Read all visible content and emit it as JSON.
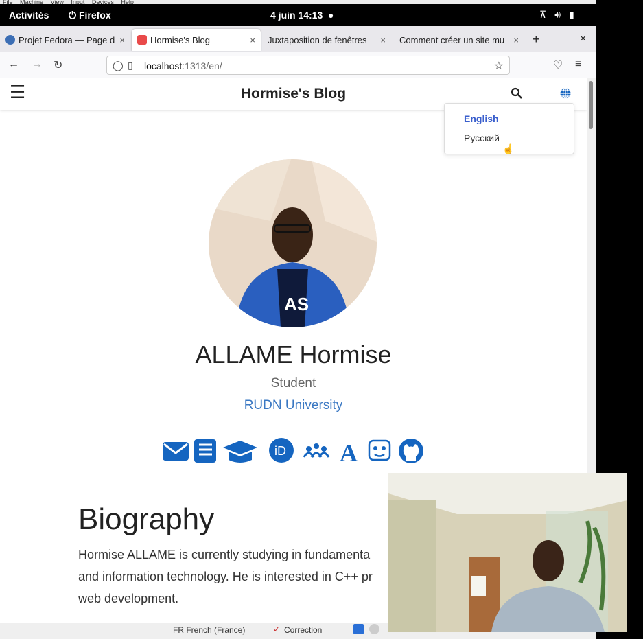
{
  "vm_menu": "File Machine View Input Devices Help",
  "topbar": {
    "activities": "Activités",
    "app": "Firefox",
    "clock": "4 juin 14:13"
  },
  "tabs": [
    {
      "title": "Projet Fedora — Page d"
    },
    {
      "title": "Hormise's Blog"
    },
    {
      "title": "Juxtaposition de fenêtres"
    },
    {
      "title": "Comment créer un site mu"
    }
  ],
  "url": {
    "host": "localhost",
    "path": ":1313/en/"
  },
  "site": {
    "title": "Hormise's Blog",
    "languages": [
      "English",
      "Русский"
    ],
    "name": "ALLAME Hormise",
    "role": "Student",
    "affiliation": "RUDN University",
    "bio_heading": "Biography",
    "bio_lines": [
      "Hormise ALLAME is currently studying in fundamenta",
      "and information technology. He is interested in C++ pr",
      "web development."
    ]
  },
  "taskbar": {
    "lang": "FR French (France)",
    "correction": "Correction"
  },
  "colors": {
    "accent": "#1565c0",
    "link": "#3a78c3"
  }
}
